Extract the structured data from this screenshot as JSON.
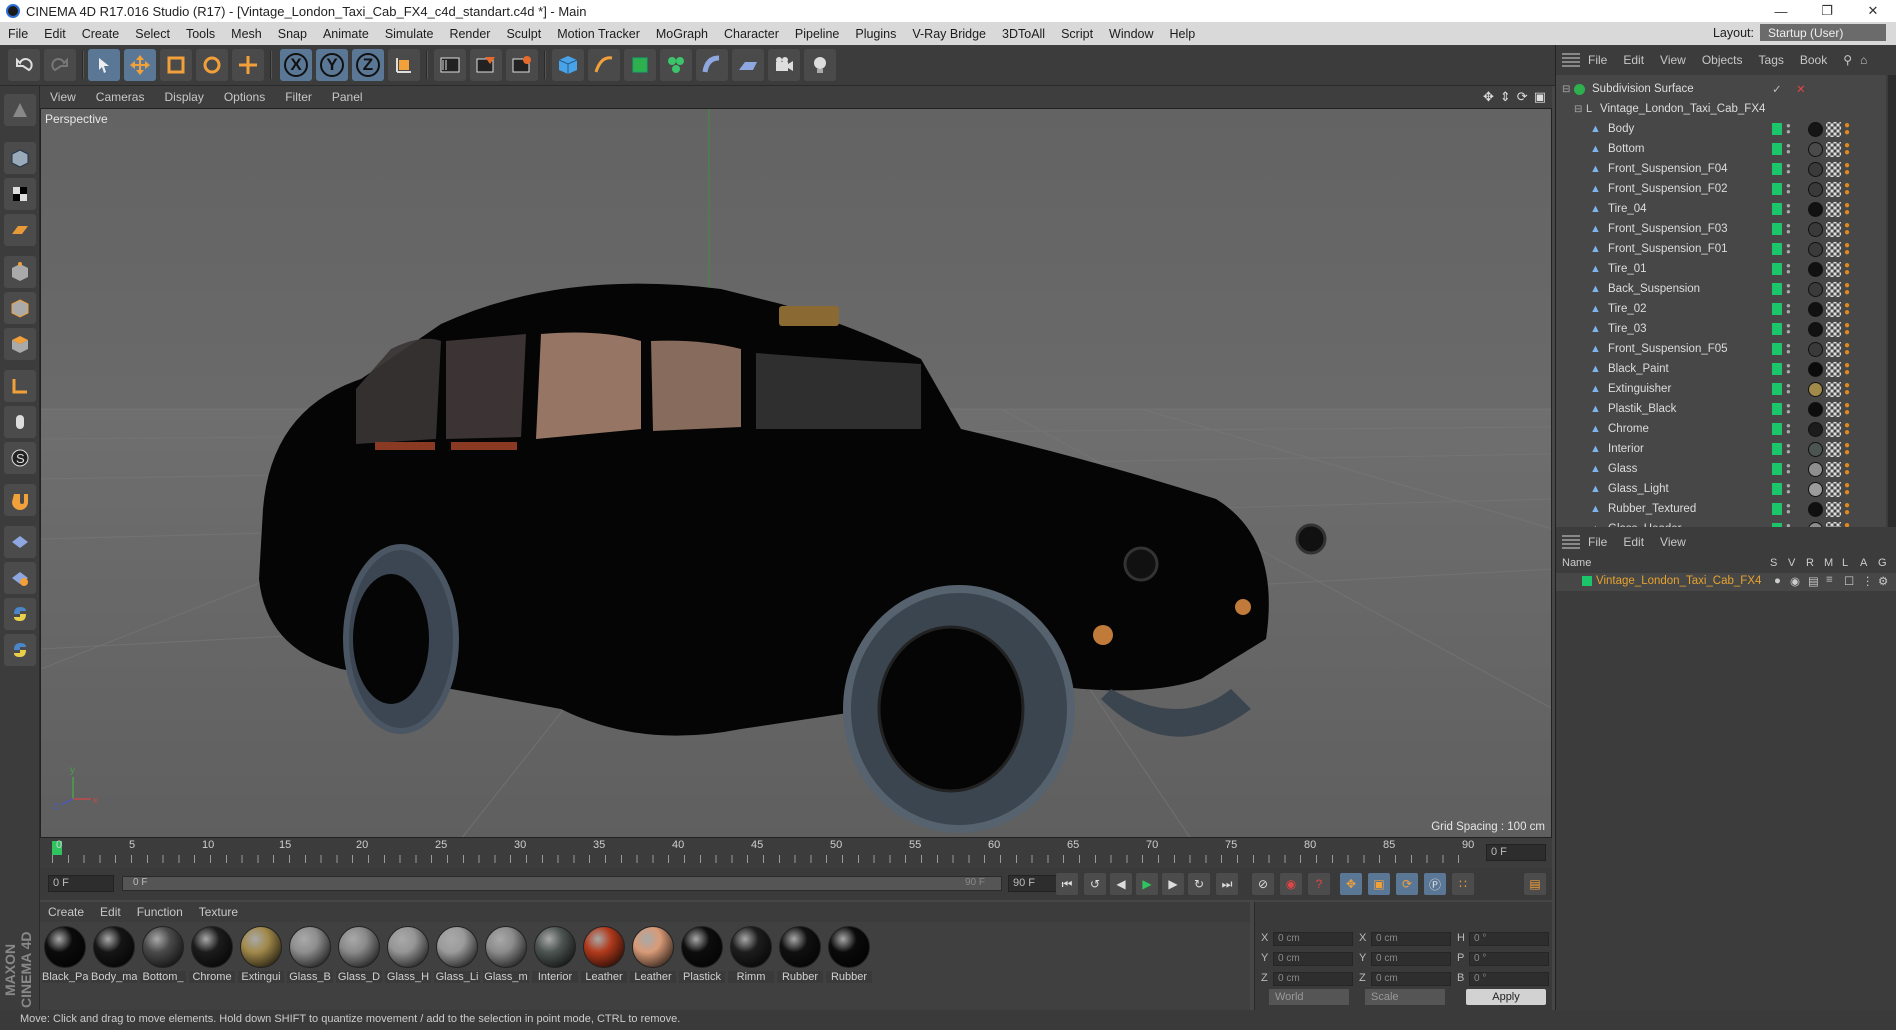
{
  "window": {
    "title": "CINEMA 4D R17.016 Studio (R17) - [Vintage_London_Taxi_Cab_FX4_c4d_standart.c4d *] - Main"
  },
  "menubar": {
    "items": [
      "File",
      "Edit",
      "Create",
      "Select",
      "Tools",
      "Mesh",
      "Snap",
      "Animate",
      "Simulate",
      "Render",
      "Sculpt",
      "Motion Tracker",
      "MoGraph",
      "Character",
      "Pipeline",
      "Plugins",
      "V-Ray Bridge",
      "3DToAll",
      "Script",
      "Window",
      "Help"
    ],
    "layout_label": "Layout:",
    "layout_value": "Startup (User)"
  },
  "toolbar": {
    "axis_labels": [
      "X",
      "Y",
      "Z"
    ]
  },
  "viewport": {
    "menu": [
      "View",
      "Cameras",
      "Display",
      "Options",
      "Filter",
      "Panel"
    ],
    "label": "Perspective",
    "grid_spacing": "Grid Spacing : 100 cm"
  },
  "timeline": {
    "ticks": [
      "0",
      "5",
      "10",
      "15",
      "20",
      "25",
      "30",
      "35",
      "40",
      "45",
      "50",
      "55",
      "60",
      "65",
      "70",
      "75",
      "80",
      "85",
      "90"
    ],
    "current_frame": "0 F",
    "start_frame": "0 F",
    "range_start": "0 F",
    "range_end": "90 F",
    "end_frame": "90 F"
  },
  "materials": {
    "menu": [
      "Create",
      "Edit",
      "Function",
      "Texture"
    ],
    "items": [
      {
        "name": "Black_Pa",
        "color": "#0b0b0b"
      },
      {
        "name": "Body_ma",
        "color": "#151515"
      },
      {
        "name": "Bottom_",
        "color": "#4a4a4a"
      },
      {
        "name": "Chrome",
        "color": "#1c1c1c"
      },
      {
        "name": "Extingui",
        "color": "#a1894a"
      },
      {
        "name": "Glass_B",
        "color": "#8e8e8e"
      },
      {
        "name": "Glass_D",
        "color": "#8a8a8a"
      },
      {
        "name": "Glass_H",
        "color": "#959595"
      },
      {
        "name": "Glass_Li",
        "color": "#9b9b9b"
      },
      {
        "name": "Glass_m",
        "color": "#8c8c8c"
      },
      {
        "name": "Interior",
        "color": "#4d5553"
      },
      {
        "name": "Leather",
        "color": "#b13a1c"
      },
      {
        "name": "Leather",
        "color": "#d99b78"
      },
      {
        "name": "Plastick",
        "color": "#0d0d0d"
      },
      {
        "name": "Rimm",
        "color": "#1d1d1d"
      },
      {
        "name": "Rubber",
        "color": "#101010"
      },
      {
        "name": "Rubber",
        "color": "#0a0a0a"
      }
    ]
  },
  "coords": {
    "rows": [
      {
        "a": "X",
        "av": "0 cm",
        "b": "X",
        "bv": "0 cm",
        "c": "H",
        "cv": "0 °"
      },
      {
        "a": "Y",
        "av": "0 cm",
        "b": "Y",
        "bv": "0 cm",
        "c": "P",
        "cv": "0 °"
      },
      {
        "a": "Z",
        "av": "0 cm",
        "b": "Z",
        "bv": "0 cm",
        "c": "B",
        "cv": "0 °"
      }
    ],
    "world": "World",
    "scale": "Scale",
    "apply": "Apply"
  },
  "object_manager": {
    "menu": [
      "File",
      "Edit",
      "View",
      "Objects",
      "Tags",
      "Book"
    ],
    "root": "Subdivision Surface",
    "group": "Vintage_London_Taxi_Cab_FX4",
    "objects": [
      {
        "name": "Body",
        "mat": "#151515"
      },
      {
        "name": "Bottom",
        "mat": "#4a4a4a"
      },
      {
        "name": "Front_Suspension_F04",
        "mat": "#3a3a3a"
      },
      {
        "name": "Front_Suspension_F02",
        "mat": "#3a3a3a"
      },
      {
        "name": "Tire_04",
        "mat": "#111111"
      },
      {
        "name": "Front_Suspension_F03",
        "mat": "#3a3a3a"
      },
      {
        "name": "Front_Suspension_F01",
        "mat": "#3a3a3a"
      },
      {
        "name": "Tire_01",
        "mat": "#111111"
      },
      {
        "name": "Back_Suspension",
        "mat": "#3a3a3a"
      },
      {
        "name": "Tire_02",
        "mat": "#111111"
      },
      {
        "name": "Tire_03",
        "mat": "#111111"
      },
      {
        "name": "Front_Suspension_F05",
        "mat": "#3a3a3a"
      },
      {
        "name": "Black_Paint",
        "mat": "#0b0b0b"
      },
      {
        "name": "Extinguisher",
        "mat": "#a1894a"
      },
      {
        "name": "Plastik_Black",
        "mat": "#0d0d0d"
      },
      {
        "name": "Chrome",
        "mat": "#1c1c1c"
      },
      {
        "name": "Interior",
        "mat": "#4d5553"
      },
      {
        "name": "Glass",
        "mat": "#8e8e8e"
      },
      {
        "name": "Glass_Light",
        "mat": "#9b9b9b"
      },
      {
        "name": "Rubber_Textured",
        "mat": "#101010"
      },
      {
        "name": "Glass_Header",
        "mat": "#8c8c8c"
      }
    ]
  },
  "layers": {
    "menu": [
      "File",
      "Edit",
      "View"
    ],
    "columns": [
      "Name",
      "S",
      "V",
      "R",
      "M",
      "L",
      "A",
      "G"
    ],
    "row": "Vintage_London_Taxi_Cab_FX4"
  },
  "status": "Move: Click and drag to move elements. Hold down SHIFT to quantize movement / add to the selection in point mode, CTRL to remove.",
  "brand": "MAXON CINEMA 4D",
  "colors": {
    "accent": "#5a7896",
    "active_object": "#e6a32f",
    "visible_green": "#1cc46a"
  }
}
